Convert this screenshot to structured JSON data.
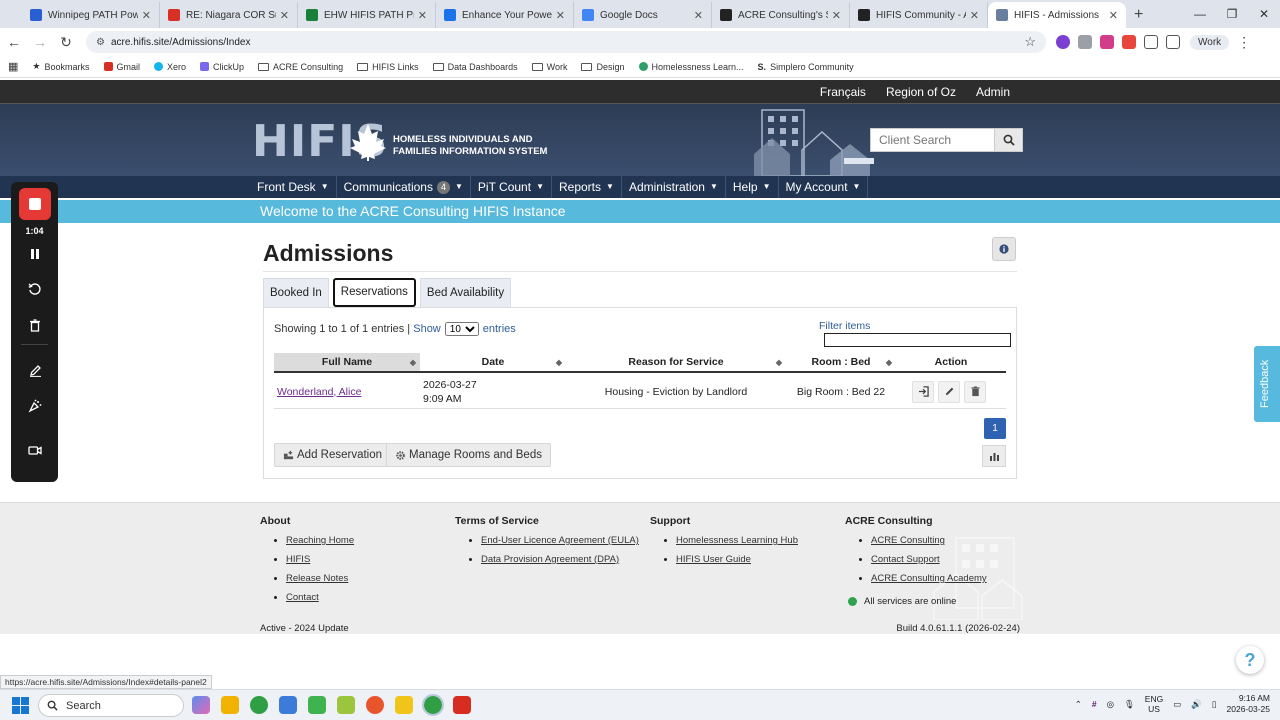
{
  "browser": {
    "tabs": [
      {
        "title": "Winnipeg PATH Power BI",
        "color": "#2a5fd3"
      },
      {
        "title": "RE: Niagara COR Support",
        "color": "#d93025"
      },
      {
        "title": "EHW HIFIS PATH Prioritiz...",
        "color": "#188038"
      },
      {
        "title": "Enhance Your Power BI Re...",
        "color": "#1a73e8"
      },
      {
        "title": "Google Docs",
        "color": "#4285f4"
      },
      {
        "title": "ACRE Consulting's Simple...",
        "color": "#222222"
      },
      {
        "title": "HIFIS Community - ACRE...",
        "color": "#222222"
      },
      {
        "title": "HIFIS - Admissions",
        "color": "#6a7fa0"
      }
    ],
    "url": "acre.hifis.site/Admissions/Index",
    "profile_label": "Work",
    "bookmarks": [
      "Bookmarks",
      "Gmail",
      "Xero",
      "ClickUp",
      "ACRE Consulting",
      "HIFIS Links",
      "Data Dashboards",
      "Work",
      "Design",
      "Homelessness Learn...",
      "Simplero Community"
    ]
  },
  "site": {
    "top_links": [
      "Français",
      "Region of Oz",
      "Admin"
    ],
    "logo_letters": "HIFIS",
    "logo_line1": "HOMELESS INDIVIDUALS AND",
    "logo_line2": "FAMILIES INFORMATION SYSTEM",
    "search_placeholder": "Client Search",
    "nav": [
      {
        "label": "Front Desk"
      },
      {
        "label": "Communications",
        "badge": "4"
      },
      {
        "label": "PiT Count"
      },
      {
        "label": "Reports"
      },
      {
        "label": "Administration"
      },
      {
        "label": "Help"
      },
      {
        "label": "My Account"
      }
    ],
    "welcome": "Welcome to the ACRE Consulting HIFIS Instance"
  },
  "page": {
    "title": "Admissions",
    "tabs": [
      "Booked In",
      "Reservations",
      "Bed Availability"
    ],
    "active_tab": "Reservations",
    "showing_prefix": "Showing 1 to 1 of 1 entries |",
    "show_label": "Show",
    "page_size": "10",
    "entries_label": "entries",
    "filter_label": "Filter items",
    "columns": [
      "Full Name",
      "Date",
      "Reason for Service",
      "Room : Bed",
      "Action"
    ],
    "row": {
      "full_name": "Wonderland, Alice",
      "date_line1": "2026-03-27",
      "date_line2": "9:09 AM",
      "reason": "Housing - Eviction by Landlord",
      "room_bed": "Big Room : Bed 22"
    },
    "pager_page": "1",
    "add_reservation": "Add Reservation",
    "manage_rooms": "Manage Rooms and Beds"
  },
  "footer": {
    "about": {
      "heading": "About",
      "links": [
        "Reaching Home",
        "HIFIS",
        "Release Notes",
        "Contact"
      ]
    },
    "terms": {
      "heading": "Terms of Service",
      "links": [
        "End-User Licence Agreement (EULA)",
        "Data Provision Agreement (DPA)"
      ]
    },
    "support": {
      "heading": "Support",
      "links": [
        "Homelessness Learning Hub",
        "HIFIS User Guide"
      ]
    },
    "acre": {
      "heading": "ACRE Consulting",
      "links": [
        "ACRE Consulting",
        "Contact Support",
        "ACRE Consulting Academy"
      ]
    },
    "status": "All services are online",
    "version": "Active - 2024 Update",
    "build": "Build 4.0.61.1.1 (2026-02-24)"
  },
  "feedback_label": "Feedback",
  "status_url": "https://acre.hifis.site/Admissions/Index#details-panel2",
  "recorder": {
    "time": "1:04"
  },
  "taskbar": {
    "search_label": "Search",
    "lang_line1": "ENG",
    "lang_line2": "US",
    "time": "9:16 AM",
    "date": "2026-03-25",
    "app_colors": [
      "#5b8def",
      "#f2b300",
      "#2f9e44",
      "#3d7bd9",
      "#3fb34f",
      "#9bc53d",
      "#e8552d",
      "#f0c419",
      "#2f9e44",
      "#d62d20"
    ]
  }
}
